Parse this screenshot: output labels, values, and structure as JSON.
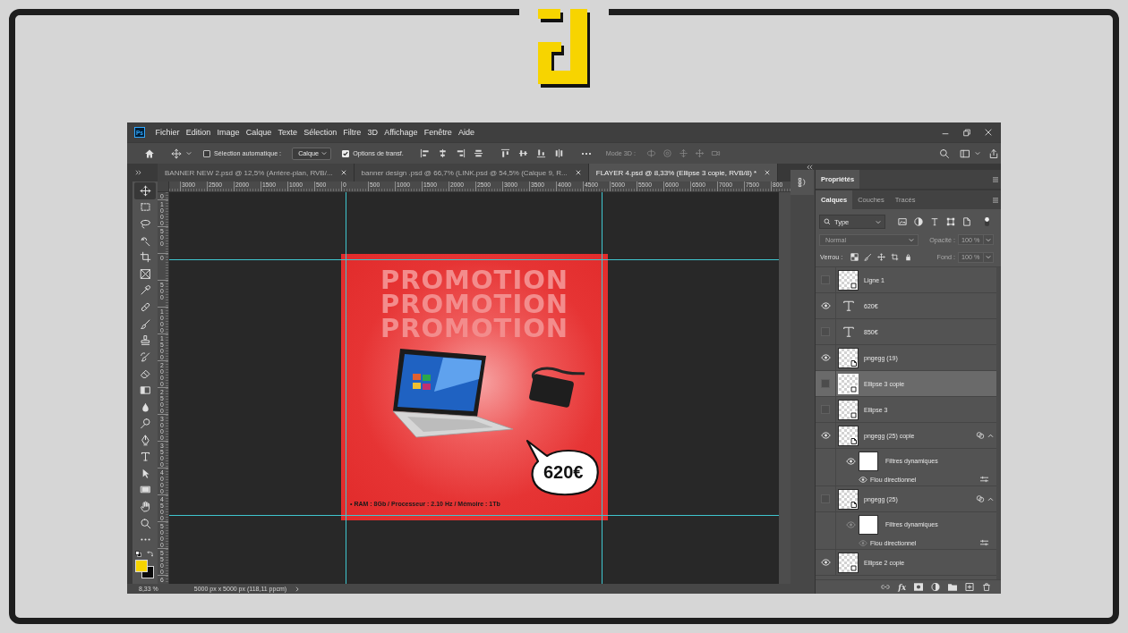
{
  "app": {
    "logo_text": "Ps"
  },
  "menu_bar": [
    "Fichier",
    "Edition",
    "Image",
    "Calque",
    "Texte",
    "Sélection",
    "Filtre",
    "3D",
    "Affichage",
    "Fenêtre",
    "Aide"
  ],
  "options_bar": {
    "auto_select": {
      "label": "Sélection automatique :",
      "checked": false
    },
    "target": {
      "value": "Calque"
    },
    "transform_controls": {
      "label": "Options de transf.",
      "checked": true
    },
    "mode_3d": {
      "label": "Mode 3D :",
      "disabled": true
    }
  },
  "documents": [
    {
      "title": "BANNER NEW 2.psd @ 12,5% (Arrière-plan, RVB/...",
      "selected": false
    },
    {
      "title": "banner design .psd @ 66,7% (LINK.psd @ 54,5% (Calque 9, R...",
      "selected": false
    },
    {
      "title": "FLAYER 4.psd @ 8,33% (Ellipse 3 copie, RVB/8) *",
      "selected": true
    }
  ],
  "tools": [
    {
      "kind": "move",
      "selected": true
    },
    {
      "kind": "marquee",
      "selected": false
    },
    {
      "kind": "lasso",
      "selected": false
    },
    {
      "kind": "quickselect",
      "selected": false
    },
    {
      "kind": "crop",
      "selected": false
    },
    {
      "kind": "frame",
      "selected": false
    },
    {
      "kind": "eyedropper",
      "selected": false
    },
    {
      "kind": "healing",
      "selected": false
    },
    {
      "kind": "brush",
      "selected": false
    },
    {
      "kind": "stamp",
      "selected": false
    },
    {
      "kind": "historybrush",
      "selected": false
    },
    {
      "kind": "eraser",
      "selected": false
    },
    {
      "kind": "gradient",
      "selected": false
    },
    {
      "kind": "blur",
      "selected": false
    },
    {
      "kind": "dodge",
      "selected": false
    },
    {
      "kind": "pen",
      "selected": false
    },
    {
      "kind": "type",
      "selected": false
    },
    {
      "kind": "pathselect",
      "selected": false
    },
    {
      "kind": "rectangle",
      "selected": false
    },
    {
      "kind": "hand",
      "selected": false
    },
    {
      "kind": "zoom",
      "selected": false
    },
    {
      "kind": "more",
      "selected": false
    }
  ],
  "color_swatches": [
    {
      "kind": "foreground",
      "color": "#f6d400"
    },
    {
      "kind": "background",
      "color": "#0a0a0a"
    }
  ],
  "rulers": {
    "horizontal": [
      "3000",
      "2500",
      "2000",
      "1500",
      "1000",
      "500",
      "0",
      "500",
      "1000",
      "1500",
      "2000",
      "2500",
      "3000",
      "3500",
      "4000",
      "4500",
      "5000",
      "5500",
      "6000",
      "6500",
      "7000",
      "7500",
      "800"
    ],
    "vertical": [
      "0",
      "1000",
      "500",
      "0",
      "500",
      "1000",
      "1500",
      "2000",
      "2500",
      "3000",
      "3500",
      "4000",
      "4500",
      "5000",
      "5500",
      "6"
    ]
  },
  "document": {
    "watermark": [
      "PROMOTION",
      "PROMOTION",
      "PROMOTION"
    ],
    "price": "620€",
    "specs": "• RAM : 8Gb / Processeur : 2.10 Hz / Mémoire : 1Tb"
  },
  "status_bar": {
    "zoom": "8,33 %",
    "document_size": "5000 px x 5000 px (118,11 ppcm)"
  },
  "properties_panel": {
    "tab": "Propriétés"
  },
  "layers_panel": {
    "tabs": [
      {
        "label": "Calques",
        "selected": true
      },
      {
        "label": "Couches",
        "selected": false
      },
      {
        "label": "Tracés",
        "selected": false
      }
    ],
    "filter": {
      "value": "Type"
    },
    "blend_mode": {
      "value": "Normal",
      "disabled": true
    },
    "opacity": {
      "label": "Opacité :",
      "value": "100 %",
      "disabled": true
    },
    "lock": {
      "label": "Verrou :"
    },
    "fill": {
      "label": "Fond :",
      "value": "100 %",
      "disabled": true
    },
    "layers": [
      {
        "name": "Ligne 1",
        "kind": "shape",
        "visible": false,
        "selected": false
      },
      {
        "name": "620€",
        "kind": "text",
        "visible": true,
        "selected": false
      },
      {
        "name": "850€",
        "kind": "text",
        "visible": false,
        "selected": false
      },
      {
        "name": "pngegg (19)",
        "kind": "smart",
        "visible": true,
        "selected": false
      },
      {
        "name": "Ellipse 3 copie",
        "kind": "shape",
        "visible": false,
        "selected": true
      },
      {
        "name": "Ellipse 3",
        "kind": "shape",
        "visible": false,
        "selected": false
      },
      {
        "name": "pngegg (25) copie",
        "kind": "smart",
        "visible": true,
        "selected": false,
        "expanded": true,
        "smart_filters": {
          "label": "Filtres dynamiques",
          "visible": true,
          "filters": [
            {
              "name": "Flou directionnel",
              "visible": true
            }
          ]
        }
      },
      {
        "name": "pngegg (25)",
        "kind": "smart",
        "visible": false,
        "selected": false,
        "expanded": true,
        "smart_filters": {
          "label": "Filtres dynamiques",
          "visible": true,
          "filters": [
            {
              "name": "Flou directionnel",
              "visible": true
            }
          ]
        }
      },
      {
        "name": "Ellipse 2 copie",
        "kind": "shape",
        "visible": true,
        "selected": false
      }
    ],
    "footer": {
      "effects_label": "fx"
    }
  }
}
